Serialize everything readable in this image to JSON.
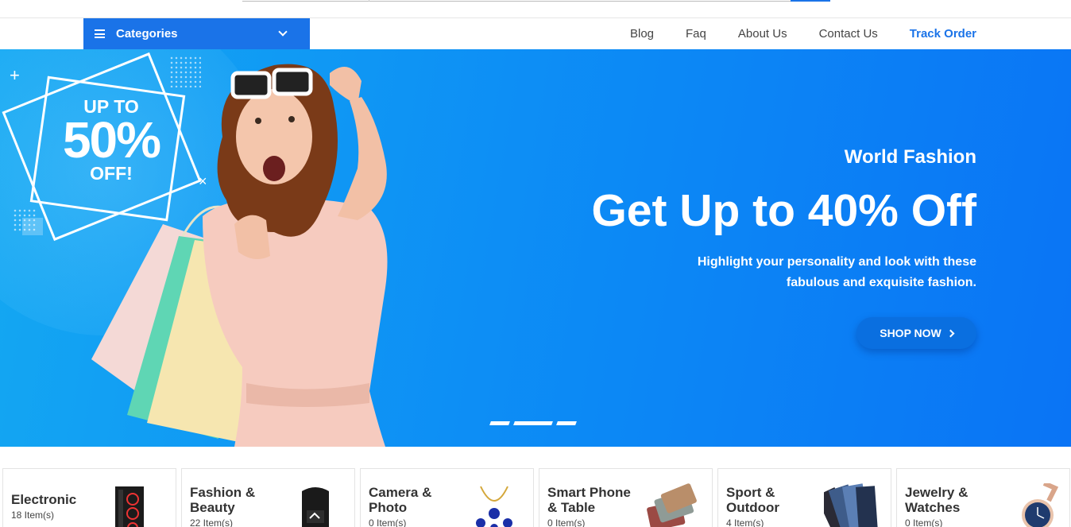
{
  "header": {
    "categories_label": "Categories",
    "menu": [
      "Blog",
      "Faq",
      "About Us",
      "Contact Us",
      "Track Order"
    ]
  },
  "hero": {
    "promo_small_top": "UP TO",
    "promo_big": "50%",
    "promo_small_bottom": "OFF!",
    "subtitle": "World Fashion",
    "title": "Get Up to 40% Off",
    "desc_line1": "Highlight your personality and look with these",
    "desc_line2": "fabulous and exquisite fashion.",
    "cta": "SHOP NOW",
    "slides": 3,
    "active_slide": 2
  },
  "categories": [
    {
      "name_line1": "Electronic",
      "name_line2": "",
      "count": "18 Item(s)",
      "icon": "desktop-tower-icon"
    },
    {
      "name_line1": "Fashion &",
      "name_line2": "Beauty",
      "count": "22 Item(s)",
      "icon": "backpack-icon"
    },
    {
      "name_line1": "Camera &",
      "name_line2": "Photo",
      "count": "0 Item(s)",
      "icon": "necklace-icon"
    },
    {
      "name_line1": "Smart Phone",
      "name_line2": "& Table",
      "count": "0 Item(s)",
      "icon": "wallets-icon"
    },
    {
      "name_line1": "Sport &",
      "name_line2": "Outdoor",
      "count": "4 Item(s)",
      "icon": "jeans-icon"
    },
    {
      "name_line1": "Jewelry &",
      "name_line2": "Watches",
      "count": "0 Item(s)",
      "icon": "watch-icon"
    }
  ],
  "colors": {
    "accent": "#1a73e8",
    "hero_start": "#14a8f2",
    "hero_end": "#0a74f5"
  }
}
